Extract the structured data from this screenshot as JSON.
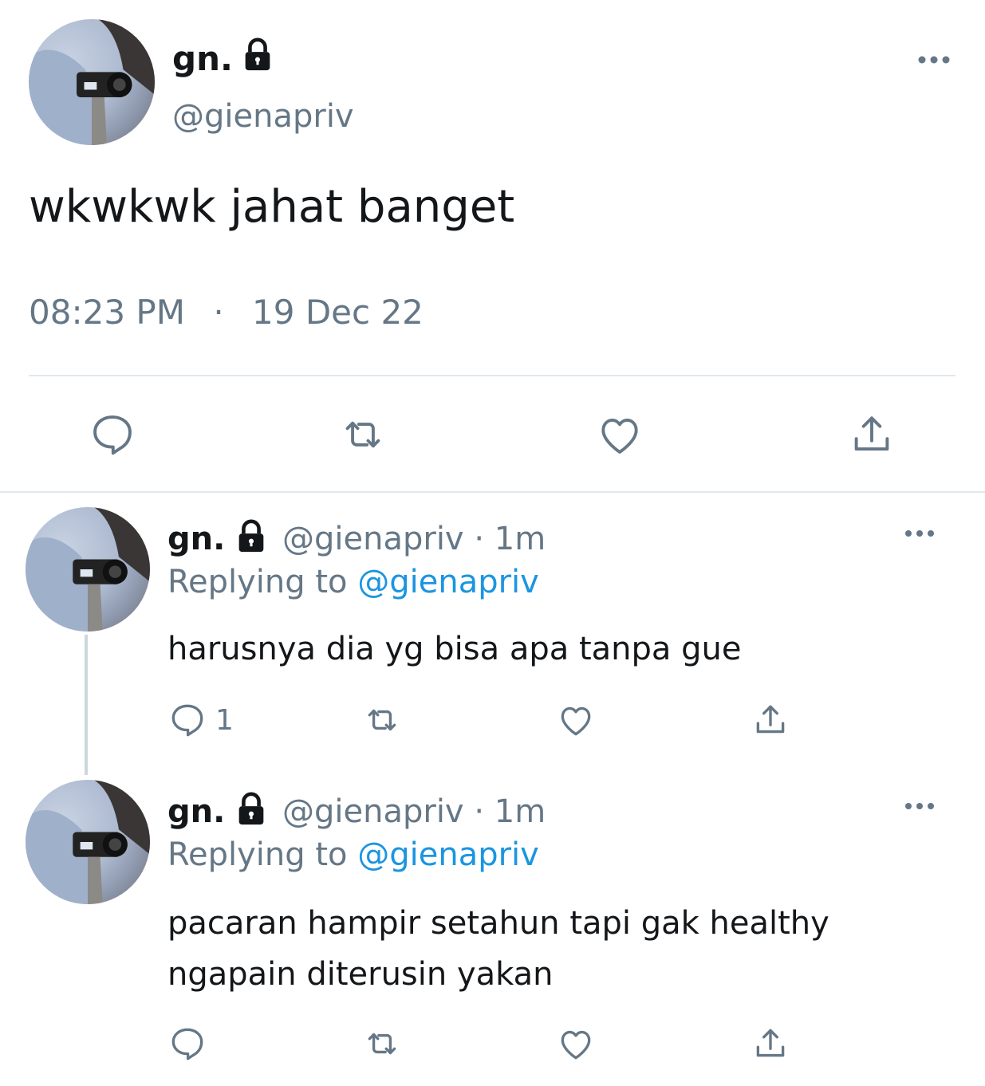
{
  "main_tweet": {
    "name": "gn.",
    "handle": "@gienapriv",
    "text": "wkwkwk jahat banget",
    "time": "08:23 PM",
    "separator": "·",
    "date": "19 Dec 22"
  },
  "replies": [
    {
      "name": "gn.",
      "handle_time": "@gienapriv · 1m",
      "replying_prefix": "Replying to",
      "replying_handle": "@gienapriv",
      "text_lines": [
        "harusnya dia yg bisa apa tanpa gue"
      ],
      "reply_count": "1"
    },
    {
      "name": "gn.",
      "handle_time": "@gienapriv · 1m",
      "replying_prefix": "Replying to",
      "replying_handle": "@gienapriv",
      "text_lines": [
        "pacaran hampir setahun tapi gak healthy",
        "ngapain diterusin yakan"
      ],
      "reply_count": ""
    }
  ],
  "icons": {
    "more": "more-options-icon",
    "lock": "lock-icon",
    "reply": "reply-icon",
    "retweet": "retweet-icon",
    "like": "like-icon",
    "share": "share-icon"
  },
  "colors": {
    "text": "#14171a",
    "muted": "#657786",
    "link": "#1b95e0",
    "divider": "#e1e8ed"
  }
}
